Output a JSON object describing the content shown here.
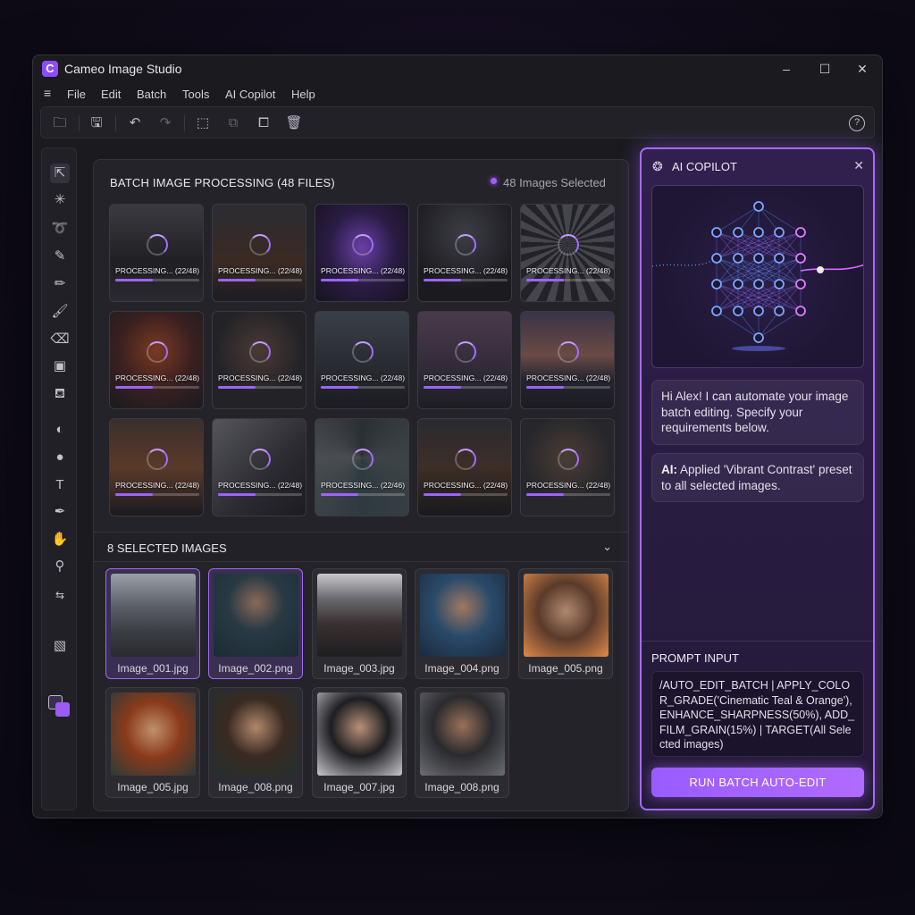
{
  "window": {
    "logo_letter": "C",
    "title": "Cameo Image Studio",
    "minimize": "–",
    "maximize": "☐",
    "close": "✕"
  },
  "menu": {
    "burger": "≡",
    "items": [
      "File",
      "Edit",
      "Batch",
      "Tools",
      "AI Copilot",
      "Help"
    ]
  },
  "toolbar": {
    "open_icon": "🗀",
    "save_icon": "🖫",
    "undo_icon": "↶",
    "redo_icon": "↷",
    "crop_icon": "⬚",
    "copy_icon": "⧉",
    "export_icon": "⧠",
    "delete_icon": "🗑",
    "help": "?"
  },
  "tools": [
    {
      "name": "select-tool",
      "glyph": "⇱"
    },
    {
      "name": "magic-wand-tool",
      "glyph": "✳"
    },
    {
      "name": "lasso-tool",
      "glyph": "➰"
    },
    {
      "name": "eyedropper-tool",
      "glyph": "✎"
    },
    {
      "name": "pencil-tool",
      "glyph": "✏"
    },
    {
      "name": "brush-tool",
      "glyph": "🖌"
    },
    {
      "name": "eraser-tool",
      "glyph": "⌫"
    },
    {
      "name": "gradient-tool",
      "glyph": "▣"
    },
    {
      "name": "clone-stamp-tool",
      "glyph": "⛾"
    },
    {
      "name": "dodge-tool",
      "glyph": "◐"
    },
    {
      "name": "burn-tool",
      "glyph": "●"
    },
    {
      "name": "text-tool",
      "glyph": "T"
    },
    {
      "name": "pen-tool",
      "glyph": "✒"
    },
    {
      "name": "hand-tool",
      "glyph": "✋"
    },
    {
      "name": "zoom-tool",
      "glyph": "⚲"
    },
    {
      "name": "swap-colors",
      "glyph": "⇆"
    },
    {
      "name": "quick-mask-tool",
      "glyph": "▧"
    }
  ],
  "colors": {
    "accent": "#9d63ff",
    "accent_glow": "#a56bff",
    "foreground_swatch": "#3a2e52",
    "background_swatch": "#9a5cf5"
  },
  "batch": {
    "title": "BATCH IMAGE PROCESSING (48 FILES)",
    "selected_count": "48 Images Selected",
    "progress_fraction": 0.45,
    "cards": [
      {
        "label": "PROCESSING... (22/48)",
        "bg": "linear-gradient(180deg,#3a3a40 0%,#1f1f24 60%,#2a2a30 100%)"
      },
      {
        "label": "PROCESSING... (22/48)",
        "bg": "linear-gradient(180deg,#2c2c33 0%,#3a2a22 60%,#1c1c22 100%)"
      },
      {
        "label": "PROCESSING... (22/48)",
        "bg": "radial-gradient(ellipse at 50% 45%,#6a3fa8 0%,#2a1c44 50%,#17121f 100%)"
      },
      {
        "label": "PROCESSING... (22/48)",
        "bg": "radial-gradient(circle at 50% 30%,#3d3d45 0%,#1a1a1f 70%)"
      },
      {
        "label": "PROCESSING... (22/48)",
        "bg": "repeating-conic-gradient(from 0deg at 50% 40%,#45454c 0deg 8deg,#222228 8deg 16deg)"
      },
      {
        "label": "PROCESSING... (22/48)",
        "bg": "radial-gradient(circle at 50% 40%,#7a3a22 0%,#3a2020 50%,#1b1a1f 100%)"
      },
      {
        "label": "PROCESSING... (22/48)",
        "bg": "radial-gradient(circle at 50% 40%,#4a3a34 0%,#232227 60%)"
      },
      {
        "label": "PROCESSING... (22/48)",
        "bg": "linear-gradient(180deg,#3a4048 0%,#2a2d33 50%,#1c1c22 100%)"
      },
      {
        "label": "PROCESSING... (22/48)",
        "bg": "linear-gradient(180deg,#4a3a4a 0%,#3a3040 40%,#1d1d24 100%)"
      },
      {
        "label": "PROCESSING... (22/48)",
        "bg": "linear-gradient(180deg,#3a3348 0%,#6a4a44 45%,#252530 70%,#1b1b20 100%)"
      },
      {
        "label": "PROCESSING... (22/48)",
        "bg": "linear-gradient(180deg,#3a2e2c 0%,#5a3a2a 50%,#1c1a1f 100%)"
      },
      {
        "label": "PROCESSING... (22/48)",
        "bg": "linear-gradient(135deg,#55555c 0%,#2a2a30 60%,#1c1c22 100%)"
      },
      {
        "label": "PROCESSING... (22/46)",
        "bg": "conic-gradient(from 180deg at 50% 40%,#2e3a3e,#4a4d52,#2a2f33,#3e4347,#2e3a3e)"
      },
      {
        "label": "PROCESSING... (22/48)",
        "bg": "linear-gradient(180deg,#2a2a30 0%,#3d2e26 50%,#19191e 100%)"
      },
      {
        "label": "PROCESSING... (22/48)",
        "bg": "radial-gradient(circle at 50% 40%,#4a3d35 0%,#26262b 60%)"
      }
    ]
  },
  "selected": {
    "title": "8 SELECTED IMAGES",
    "chevron": "⌄",
    "items": [
      {
        "caption": "Image_001.jpg",
        "selected": true,
        "bg": "linear-gradient(180deg,#9aa0a8 0%,#5a5e66 40%,#3a3d42 70%,#2a2b30 100%)"
      },
      {
        "caption": "Image_002.png",
        "selected": true,
        "bg": "radial-gradient(circle at 50% 35%,#8a6a58 0%,#2a3a44 40%,#1b2a33 100%)"
      },
      {
        "caption": "Image_003.jpg",
        "selected": false,
        "bg": "linear-gradient(180deg,#c8c8cc 0%,#6a6a70 30%,#3a3030 60%,#1e1e22 100%)"
      },
      {
        "caption": "Image_004.png",
        "selected": false,
        "bg": "radial-gradient(circle at 50% 40%,#a07860 0%,#2a4a6a 45%,#1a2a3e 100%)"
      },
      {
        "caption": "Image_005.png",
        "selected": false,
        "bg": "radial-gradient(circle at 50% 45%,#b08870 0%,#5a3a2a 45%,#e08a4a 100%)"
      },
      {
        "caption": "Image_005.jpg",
        "selected": false,
        "bg": "radial-gradient(circle at 50% 45%,#c0906c 0%,#8a3a1a 45%,#2a3a3a 100%)"
      },
      {
        "caption": "Image_008.png",
        "selected": false,
        "bg": "radial-gradient(circle at 50% 42%,#b0886c 0%,#3a2a22 45%,#23302e 100%)"
      },
      {
        "caption": "Image_007.jpg",
        "selected": false,
        "bg": "radial-gradient(circle at 50% 42%,#b89078 0%,#1e1e22 45%,#c8c8cc 100%)"
      },
      {
        "caption": "Image_008.png",
        "selected": false,
        "bg": "radial-gradient(circle at 50% 40%,#9a7058 0%,#2a2a2e 45%,#6a6e74 100%)"
      }
    ]
  },
  "copilot": {
    "icon": "❂",
    "title": "AI COPILOT",
    "close": "✕",
    "greeting": "Hi Alex! I can automate your image batch editing. Specify your requirements below.",
    "ai_prefix": "AI:",
    "ai_message": " Applied 'Vibrant Contrast' preset to all selected images.",
    "prompt_label": "PROMPT INPUT",
    "prompt_text": "/AUTO_EDIT_BATCH | APPLY_COLOR_GRADE('Cinematic Teal & Orange'), ENHANCE_SHARPNESS(50%), ADD_FILM_GRAIN(15%) | TARGET(All Selected images)",
    "run_button": "RUN BATCH AUTO-EDIT"
  }
}
